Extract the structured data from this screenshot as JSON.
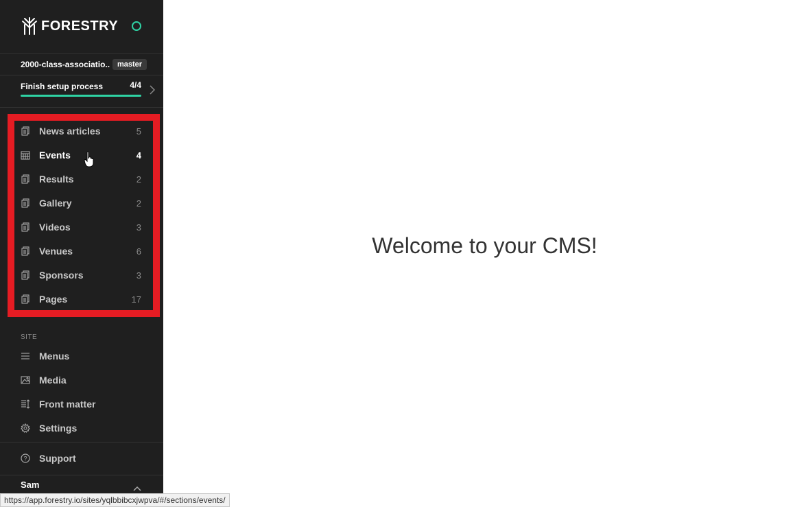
{
  "brand": {
    "name": "FORESTRY",
    "status_color": "#2fd3a4"
  },
  "repo": {
    "name": "2000-class-associatio...",
    "branch": "master"
  },
  "setup": {
    "label": "Finish setup process",
    "count": "4/4",
    "progress": 1.0
  },
  "sections": [
    {
      "label": "News articles",
      "count": "5",
      "icon": "document-icon"
    },
    {
      "label": "Events",
      "count": "4",
      "icon": "calendar-icon",
      "active": true
    },
    {
      "label": "Results",
      "count": "2",
      "icon": "document-icon"
    },
    {
      "label": "Gallery",
      "count": "2",
      "icon": "document-icon"
    },
    {
      "label": "Videos",
      "count": "3",
      "icon": "document-icon"
    },
    {
      "label": "Venues",
      "count": "6",
      "icon": "document-icon"
    },
    {
      "label": "Sponsors",
      "count": "3",
      "icon": "document-icon"
    },
    {
      "label": "Pages",
      "count": "17",
      "icon": "document-icon"
    }
  ],
  "site": {
    "heading": "SITE",
    "items": [
      {
        "label": "Menus",
        "icon": "menu-icon"
      },
      {
        "label": "Media",
        "icon": "image-icon"
      },
      {
        "label": "Front matter",
        "icon": "front-matter-icon"
      },
      {
        "label": "Settings",
        "icon": "gear-icon"
      }
    ]
  },
  "support": {
    "label": "Support",
    "icon": "help-icon"
  },
  "user": {
    "name": "Sam"
  },
  "status_url": "https://app.forestry.io/sites/yqlbbibcxjwpva/#/sections/events/",
  "main": {
    "welcome": "Welcome to your CMS!"
  },
  "colors": {
    "highlight": "#e51c23",
    "sidebar_bg": "#1f1f1f",
    "accent": "#2fd3a4"
  }
}
